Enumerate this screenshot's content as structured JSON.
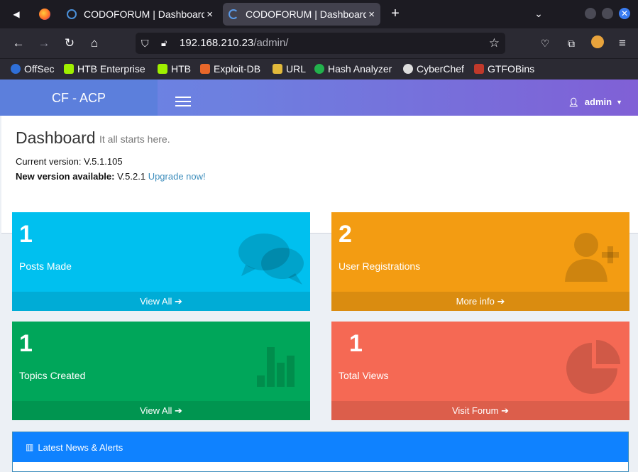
{
  "browser": {
    "tabs": [
      {
        "title": "CODOFORUM | Dashboard"
      },
      {
        "title": "CODOFORUM | Dashboard"
      }
    ],
    "new_tab_glyph": "+",
    "close_glyph": "×",
    "url_host": "192.168.210.23",
    "url_path": "/admin/",
    "bookmarks": [
      {
        "label": "OffSec",
        "color": "#2f6fd8"
      },
      {
        "label": "HTB Enterprise",
        "color": "#9fef00"
      },
      {
        "label": "HTB",
        "color": "#9fef00"
      },
      {
        "label": "Exploit-DB",
        "color": "#e8672a"
      },
      {
        "label": "URL",
        "color": "#e2b93b"
      },
      {
        "label": "Hash Analyzer",
        "color": "#22b14c"
      },
      {
        "label": "CyberChef",
        "color": "#dddddd"
      },
      {
        "label": "GTFOBins",
        "color": "#c0392b"
      }
    ]
  },
  "app": {
    "logo": "CF - ACP",
    "user": "admin",
    "title": "Dashboard",
    "subtitle": "It all starts here.",
    "current_version": "Current version: V.5.1.105",
    "new_version_label": "New version available:",
    "new_version_value": " V.5.2.1 ",
    "upgrade_link": "Upgrade now!",
    "boxes": [
      {
        "number": "1",
        "label": "Posts Made",
        "footer": "View All",
        "color": "#00c0ef",
        "icon": "comments-icon"
      },
      {
        "number": "2",
        "label": "User Registrations",
        "footer": "More info",
        "color": "#f39c12",
        "icon": "user-plus-icon"
      },
      {
        "number": "1",
        "label": "Topics Created",
        "footer": "View All",
        "color": "#00a65a",
        "icon": "bar-chart-icon"
      },
      {
        "number": "1",
        "label": "Total Views",
        "footer": "Visit Forum",
        "color": "#f56954",
        "icon": "pie-chart-icon"
      }
    ],
    "news_title": "Latest News & Alerts"
  }
}
